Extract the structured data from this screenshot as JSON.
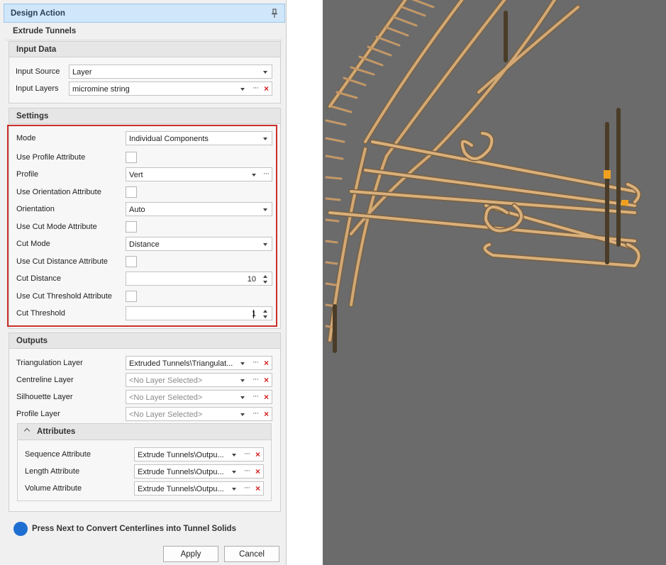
{
  "panel": {
    "title": "Design Action",
    "subtitle": "Extrude Tunnels"
  },
  "input_data": {
    "header": "Input Data",
    "source_label": "Input Source",
    "source_value": "Layer",
    "layers_label": "Input Layers",
    "layers_value": "micromine string"
  },
  "settings": {
    "header": "Settings",
    "mode_label": "Mode",
    "mode_value": "Individual Components",
    "use_profile_attr_label": "Use Profile Attribute",
    "profile_label": "Profile",
    "profile_value": "Vert",
    "use_orientation_attr_label": "Use Orientation Attribute",
    "orientation_label": "Orientation",
    "orientation_value": "Auto",
    "use_cut_mode_attr_label": "Use Cut Mode Attribute",
    "cut_mode_label": "Cut Mode",
    "cut_mode_value": "Distance",
    "use_cut_distance_attr_label": "Use Cut Distance Attribute",
    "cut_distance_label": "Cut Distance",
    "cut_distance_value": "10",
    "use_cut_threshold_attr_label": "Use Cut Threshold Attribute",
    "cut_threshold_label": "Cut Threshold",
    "cut_threshold_value": "1"
  },
  "outputs": {
    "header": "Outputs",
    "triangulation_label": "Triangulation Layer",
    "triangulation_value": "Extruded Tunnels\\Triangulat...",
    "centreline_label": "Centreline Layer",
    "centreline_value": "<No Layer Selected>",
    "silhouette_label": "Silhouette Layer",
    "silhouette_value": "<No Layer Selected>",
    "profile_layer_label": "Profile Layer",
    "profile_layer_value": "<No Layer Selected>",
    "attributes": {
      "header": "Attributes",
      "sequence_label": "Sequence Attribute",
      "sequence_value": "Extrude Tunnels\\Outpu...",
      "length_label": "Length Attribute",
      "length_value": "Extrude Tunnels\\Outpu...",
      "volume_label": "Volume Attribute",
      "volume_value": "Extrude Tunnels\\Outpu..."
    }
  },
  "info": {
    "text": "Press Next to Convert Centerlines into Tunnel Solids"
  },
  "buttons": {
    "apply": "Apply",
    "cancel": "Cancel"
  },
  "icons": {
    "pin": "pin-icon",
    "dropdown": "chevron-down-icon",
    "browse": "ellipsis-icon",
    "clear": "close-icon",
    "collapse": "chevron-up-icon",
    "info": "info-icon"
  },
  "colors": {
    "header_bg": "#cfe6fb",
    "highlight": "#c9302c",
    "clear_icon": "#d21e1e",
    "info_dot": "#1e6fd1",
    "viewport_bg": "#6b6b6b",
    "tunnel": "#d2a874",
    "marker": "#f0a020"
  }
}
